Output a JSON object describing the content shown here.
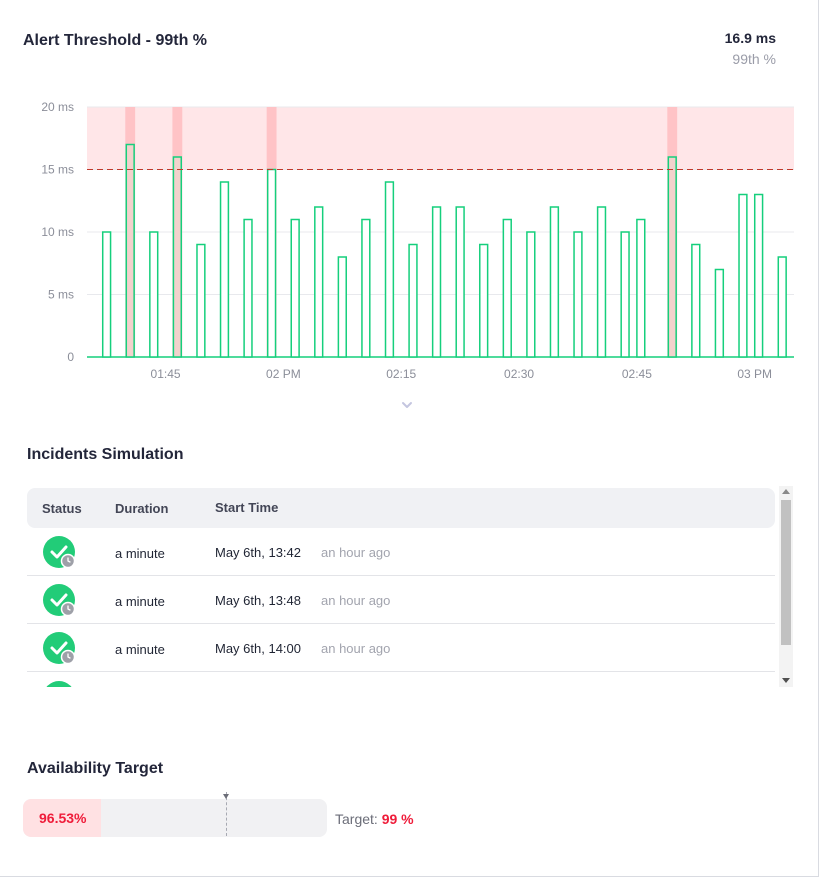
{
  "header": {
    "title": "Alert Threshold - 99th %",
    "current_value": "16.9 ms",
    "current_label": "99th %"
  },
  "colors": {
    "ok_line": "#15cf7c",
    "breach_fill": "#f2d2cc",
    "threshold_zone": "#ffe6e8",
    "threshold_line": "#c0392b",
    "breach_band": "#ffbcc0",
    "status_ok": "#22cc78",
    "error_text": "#ef1c3a"
  },
  "chart_data": {
    "type": "bar",
    "title": "Alert Threshold - 99th %",
    "x_start": "01:35",
    "x_end": "03:05",
    "x_ticks": [
      "01:45",
      "02 PM",
      "02:15",
      "02:30",
      "02:45",
      "03 PM"
    ],
    "y_ticks": [
      "0",
      "5 ms",
      "10 ms",
      "15 ms",
      "20 ms"
    ],
    "y_unit": "ms",
    "ylim": [
      0,
      20
    ],
    "threshold": 15,
    "grid": true,
    "series": [
      {
        "values": [
          {
            "start": "01:37",
            "end": "01:38",
            "y": 10
          },
          {
            "start": "01:40",
            "end": "01:41",
            "y": 17
          },
          {
            "start": "01:43",
            "end": "01:44",
            "y": 10
          },
          {
            "start": "01:46",
            "end": "01:47",
            "y": 16
          },
          {
            "start": "01:49",
            "end": "01:50",
            "y": 9
          },
          {
            "start": "01:52",
            "end": "01:53",
            "y": 14
          },
          {
            "start": "01:55",
            "end": "01:56",
            "y": 11
          },
          {
            "start": "01:58",
            "end": "01:59",
            "y": 15
          },
          {
            "start": "02:01",
            "end": "02:02",
            "y": 11
          },
          {
            "start": "02:04",
            "end": "02:05",
            "y": 12
          },
          {
            "start": "02:07",
            "end": "02:08",
            "y": 8
          },
          {
            "start": "02:10",
            "end": "02:11",
            "y": 11
          },
          {
            "start": "02:13",
            "end": "02:14",
            "y": 14
          },
          {
            "start": "02:16",
            "end": "02:17",
            "y": 9
          },
          {
            "start": "02:19",
            "end": "02:20",
            "y": 12
          },
          {
            "start": "02:22",
            "end": "02:23",
            "y": 12
          },
          {
            "start": "02:25",
            "end": "02:26",
            "y": 9
          },
          {
            "start": "02:28",
            "end": "02:29",
            "y": 11
          },
          {
            "start": "02:31",
            "end": "02:32",
            "y": 10
          },
          {
            "start": "02:34",
            "end": "02:35",
            "y": 12
          },
          {
            "start": "02:37",
            "end": "02:38",
            "y": 10
          },
          {
            "start": "02:40",
            "end": "02:41",
            "y": 12
          },
          {
            "start": "02:43",
            "end": "02:44",
            "y": 10
          },
          {
            "start": "02:45",
            "end": "02:46",
            "y": 11
          },
          {
            "start": "02:49",
            "end": "02:50",
            "y": 16
          },
          {
            "start": "02:52",
            "end": "02:53",
            "y": 9
          },
          {
            "start": "02:55",
            "end": "02:56",
            "y": 7
          },
          {
            "start": "02:58",
            "end": "02:59",
            "y": 13
          },
          {
            "start": "03:00",
            "end": "03:01",
            "y": 13
          },
          {
            "start": "03:03",
            "end": "03:04",
            "y": 8
          }
        ]
      }
    ],
    "breach_bands": [
      {
        "start": "01:40",
        "end": "01:41"
      },
      {
        "start": "01:46",
        "end": "01:47"
      },
      {
        "start": "01:58",
        "end": "01:59"
      },
      {
        "start": "02:49",
        "end": "02:50"
      }
    ]
  },
  "incidents": {
    "title": "Incidents Simulation",
    "columns": {
      "status": "Status",
      "duration": "Duration",
      "start": "Start Time"
    },
    "rows": [
      {
        "status": "resolved",
        "duration": "a minute",
        "start": "May 6th, 13:42",
        "relative": "an hour ago"
      },
      {
        "status": "resolved",
        "duration": "a minute",
        "start": "May 6th, 13:48",
        "relative": "an hour ago"
      },
      {
        "status": "resolved",
        "duration": "a minute",
        "start": "May 6th, 14:00",
        "relative": "an hour ago"
      }
    ]
  },
  "availability": {
    "title": "Availability Target",
    "value_label": "96.53%",
    "target_label": "Target:",
    "target_value": "99 %",
    "bar_min": 95,
    "bar_max": 101,
    "value": 96.53,
    "target": 99
  }
}
